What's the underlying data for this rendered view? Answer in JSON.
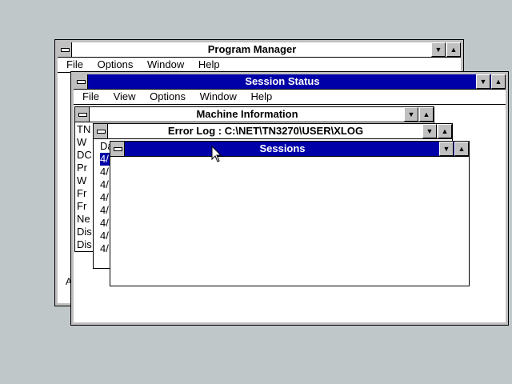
{
  "program_manager": {
    "title": "Program Manager",
    "menu": [
      "File",
      "Options",
      "Window",
      "Help"
    ],
    "left_fragment": "A"
  },
  "session_status": {
    "title": "Session Status",
    "menu": [
      "File",
      "View",
      "Options",
      "Window",
      "Help"
    ]
  },
  "machine_information": {
    "title": "Machine Information",
    "rows": [
      "TN",
      "W",
      "DC",
      "Pr",
      "W",
      "Fr",
      "Fr",
      "Ne",
      "Dis",
      "Dis"
    ]
  },
  "error_log": {
    "title": "Error Log : C:\\NET\\TN3270\\USER\\XLOG",
    "rows": [
      "Da",
      "4/",
      "4/",
      "4/",
      "4/",
      "4/",
      "4/",
      "4/",
      "4/"
    ]
  },
  "sessions": {
    "title": "Sessions"
  },
  "colors": {
    "active_title": "#0000a8",
    "desktop": "#c0c7c8"
  }
}
